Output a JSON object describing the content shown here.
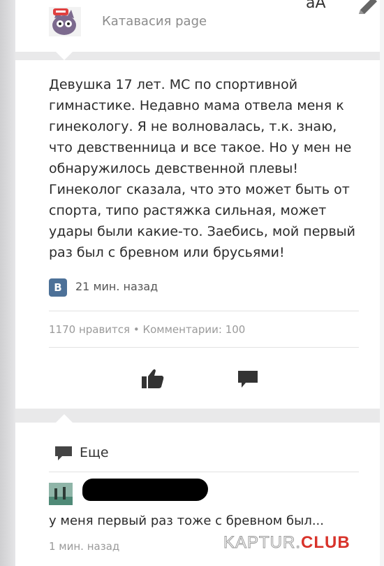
{
  "header": {
    "group_name": "Катавасия page",
    "font_size_toggle": "aA"
  },
  "post": {
    "text": "Девушка 17 лет. МС по спортивной гимнастике. Недавно мама отвела меня к гинекологу. Я не волновалась, т.к. знаю, что девственница и все такое. Но у мен не обнаружилось девственной плевы! Гинеколог сказала, что это может быть от спорта, типо растяжка сильная, может удары были какие-то. Заебись, мой первый раз был с бревном или брусьями!",
    "source_badge": "В",
    "time": "21 мин. назад",
    "stats": "1170 нравится • Комментарии: 100"
  },
  "comments": {
    "more_label": "Еще",
    "items": [
      {
        "text": "у меня первый раз тоже с бревном был...",
        "time": "1 мин. назад"
      }
    ]
  },
  "watermark": {
    "main": "KAPTUR.",
    "accent": "CLUB"
  },
  "colors": {
    "background": "#e9e9ea",
    "card": "#ffffff",
    "vk_badge": "#4d7198",
    "icon": "#333333",
    "watermark_accent": "#d8332b"
  },
  "icons": {
    "edit": "pencil-icon",
    "like": "thumbs-up-icon",
    "comment": "comment-bubble-icon",
    "more": "comment-bubble-icon"
  }
}
